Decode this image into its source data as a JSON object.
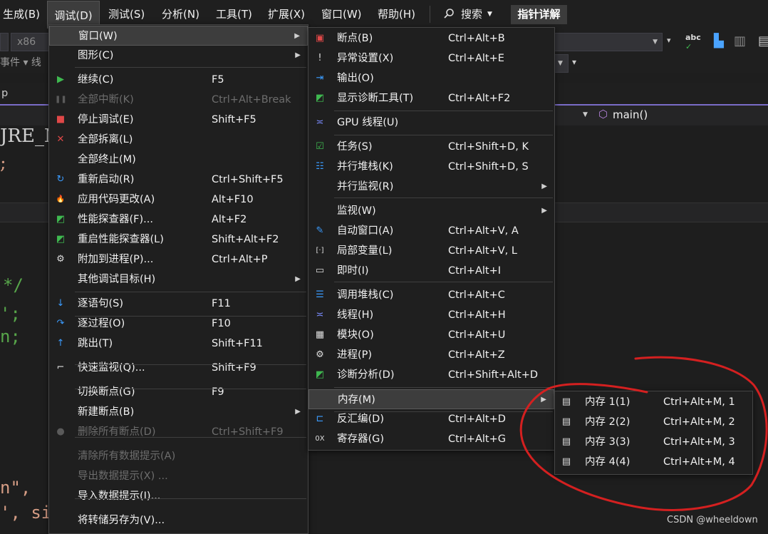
{
  "menubar": {
    "items": [
      "生成(B)",
      "调试(D)",
      "测试(S)",
      "分析(N)",
      "工具(T)",
      "扩展(X)",
      "窗口(W)",
      "帮助(H)"
    ],
    "search_label": "搜索",
    "format_button": "指针详解"
  },
  "background": {
    "platform": "x86",
    "events_label": "事件",
    "tab_text": "p",
    "nav_function": "main()",
    "code_fragments": [
      "JRE_NO",
      ";",
      "*/",
      "';",
      "n;",
      "n\",",
      "', si"
    ]
  },
  "debug_menu": {
    "items": [
      {
        "label": "窗口(W)",
        "shortcut": "",
        "submenu": true,
        "icon": ""
      },
      {
        "label": "图形(C)",
        "shortcut": "",
        "submenu": true,
        "icon": ""
      },
      {
        "label": "继续(C)",
        "shortcut": "F5",
        "icon": "play-icon"
      },
      {
        "label": "全部中断(K)",
        "shortcut": "Ctrl+Alt+Break",
        "disabled": true,
        "icon": "pause-icon"
      },
      {
        "label": "停止调试(E)",
        "shortcut": "Shift+F5",
        "icon": "stop-icon"
      },
      {
        "label": "全部拆离(L)",
        "shortcut": "",
        "icon": "detach-icon"
      },
      {
        "label": "全部终止(M)",
        "shortcut": "",
        "icon": ""
      },
      {
        "label": "重新启动(R)",
        "shortcut": "Ctrl+Shift+F5",
        "icon": "restart-icon"
      },
      {
        "label": "应用代码更改(A)",
        "shortcut": "Alt+F10",
        "icon": "hot-reload-icon"
      },
      {
        "label": "性能探查器(F)...",
        "shortcut": "Alt+F2",
        "icon": "profiler-icon"
      },
      {
        "label": "重启性能探查器(L)",
        "shortcut": "Shift+Alt+F2",
        "icon": "profiler-restart-icon"
      },
      {
        "label": "附加到进程(P)...",
        "shortcut": "Ctrl+Alt+P",
        "icon": "attach-gear-icon"
      },
      {
        "label": "其他调试目标(H)",
        "shortcut": "",
        "submenu": true,
        "icon": ""
      },
      {
        "label": "逐语句(S)",
        "shortcut": "F11",
        "icon": "step-into-icon"
      },
      {
        "label": "逐过程(O)",
        "shortcut": "F10",
        "icon": "step-over-icon"
      },
      {
        "label": "跳出(T)",
        "shortcut": "Shift+F11",
        "icon": "step-out-icon"
      },
      {
        "label": "快速监视(Q)...",
        "shortcut": "Shift+F9",
        "icon": "glasses-icon"
      },
      {
        "label": "切换断点(G)",
        "shortcut": "F9",
        "icon": ""
      },
      {
        "label": "新建断点(B)",
        "shortcut": "",
        "submenu": true,
        "icon": ""
      },
      {
        "label": "删除所有断点(D)",
        "shortcut": "Ctrl+Shift+F9",
        "disabled": true,
        "icon": "delete-breakpoints-icon"
      },
      {
        "label": "清除所有数据提示(A)",
        "shortcut": "",
        "disabled": true,
        "icon": ""
      },
      {
        "label": "导出数据提示(X) ...",
        "shortcut": "",
        "disabled": true,
        "icon": ""
      },
      {
        "label": "导入数据提示(I)...",
        "shortcut": "",
        "icon": ""
      },
      {
        "label": "将转储另存为(V)...",
        "shortcut": "",
        "icon": ""
      }
    ]
  },
  "window_menu": {
    "items": [
      {
        "label": "断点(B)",
        "shortcut": "Ctrl+Alt+B",
        "icon": "breakpoints-icon"
      },
      {
        "label": "异常设置(X)",
        "shortcut": "Ctrl+Alt+E",
        "icon": "exception-settings-icon"
      },
      {
        "label": "输出(O)",
        "shortcut": "",
        "icon": "output-icon"
      },
      {
        "label": "显示诊断工具(T)",
        "shortcut": "Ctrl+Alt+F2",
        "icon": "diagnostic-tools-icon"
      },
      {
        "label": "GPU 线程(U)",
        "shortcut": "",
        "icon": "gpu-threads-icon"
      },
      {
        "label": "任务(S)",
        "shortcut": "Ctrl+Shift+D, K",
        "icon": "tasks-icon"
      },
      {
        "label": "并行堆栈(K)",
        "shortcut": "Ctrl+Shift+D, S",
        "icon": "parallel-stacks-icon"
      },
      {
        "label": "并行监视(R)",
        "shortcut": "",
        "submenu": true,
        "icon": ""
      },
      {
        "label": "监视(W)",
        "shortcut": "",
        "submenu": true,
        "icon": ""
      },
      {
        "label": "自动窗口(A)",
        "shortcut": "Ctrl+Alt+V, A",
        "icon": "autos-icon"
      },
      {
        "label": "局部变量(L)",
        "shortcut": "Ctrl+Alt+V, L",
        "icon": "locals-icon"
      },
      {
        "label": "即时(I)",
        "shortcut": "Ctrl+Alt+I",
        "icon": "immediate-icon"
      },
      {
        "label": "调用堆栈(C)",
        "shortcut": "Ctrl+Alt+C",
        "icon": "call-stack-icon"
      },
      {
        "label": "线程(H)",
        "shortcut": "Ctrl+Alt+H",
        "icon": "threads-icon"
      },
      {
        "label": "模块(O)",
        "shortcut": "Ctrl+Alt+U",
        "icon": "modules-icon"
      },
      {
        "label": "进程(P)",
        "shortcut": "Ctrl+Alt+Z",
        "icon": "processes-icon"
      },
      {
        "label": "诊断分析(D)",
        "shortcut": "Ctrl+Shift+Alt+D",
        "icon": "diagnostic-analysis-icon"
      },
      {
        "label": "内存(M)",
        "shortcut": "",
        "submenu": true,
        "icon": ""
      },
      {
        "label": "反汇编(D)",
        "shortcut": "Ctrl+Alt+D",
        "icon": "disassembly-icon"
      },
      {
        "label": "寄存器(G)",
        "shortcut": "Ctrl+Alt+G",
        "icon": "registers-icon"
      }
    ]
  },
  "memory_menu": {
    "items": [
      {
        "label": "内存 1(1)",
        "shortcut": "Ctrl+Alt+M, 1"
      },
      {
        "label": "内存 2(2)",
        "shortcut": "Ctrl+Alt+M, 2"
      },
      {
        "label": "内存 3(3)",
        "shortcut": "Ctrl+Alt+M, 3"
      },
      {
        "label": "内存 4(4)",
        "shortcut": "Ctrl+Alt+M, 4"
      }
    ]
  },
  "watermark": "CSDN @wheeldown",
  "colors": {
    "annotation": "#d42020",
    "accent": "#7a6cc8"
  }
}
